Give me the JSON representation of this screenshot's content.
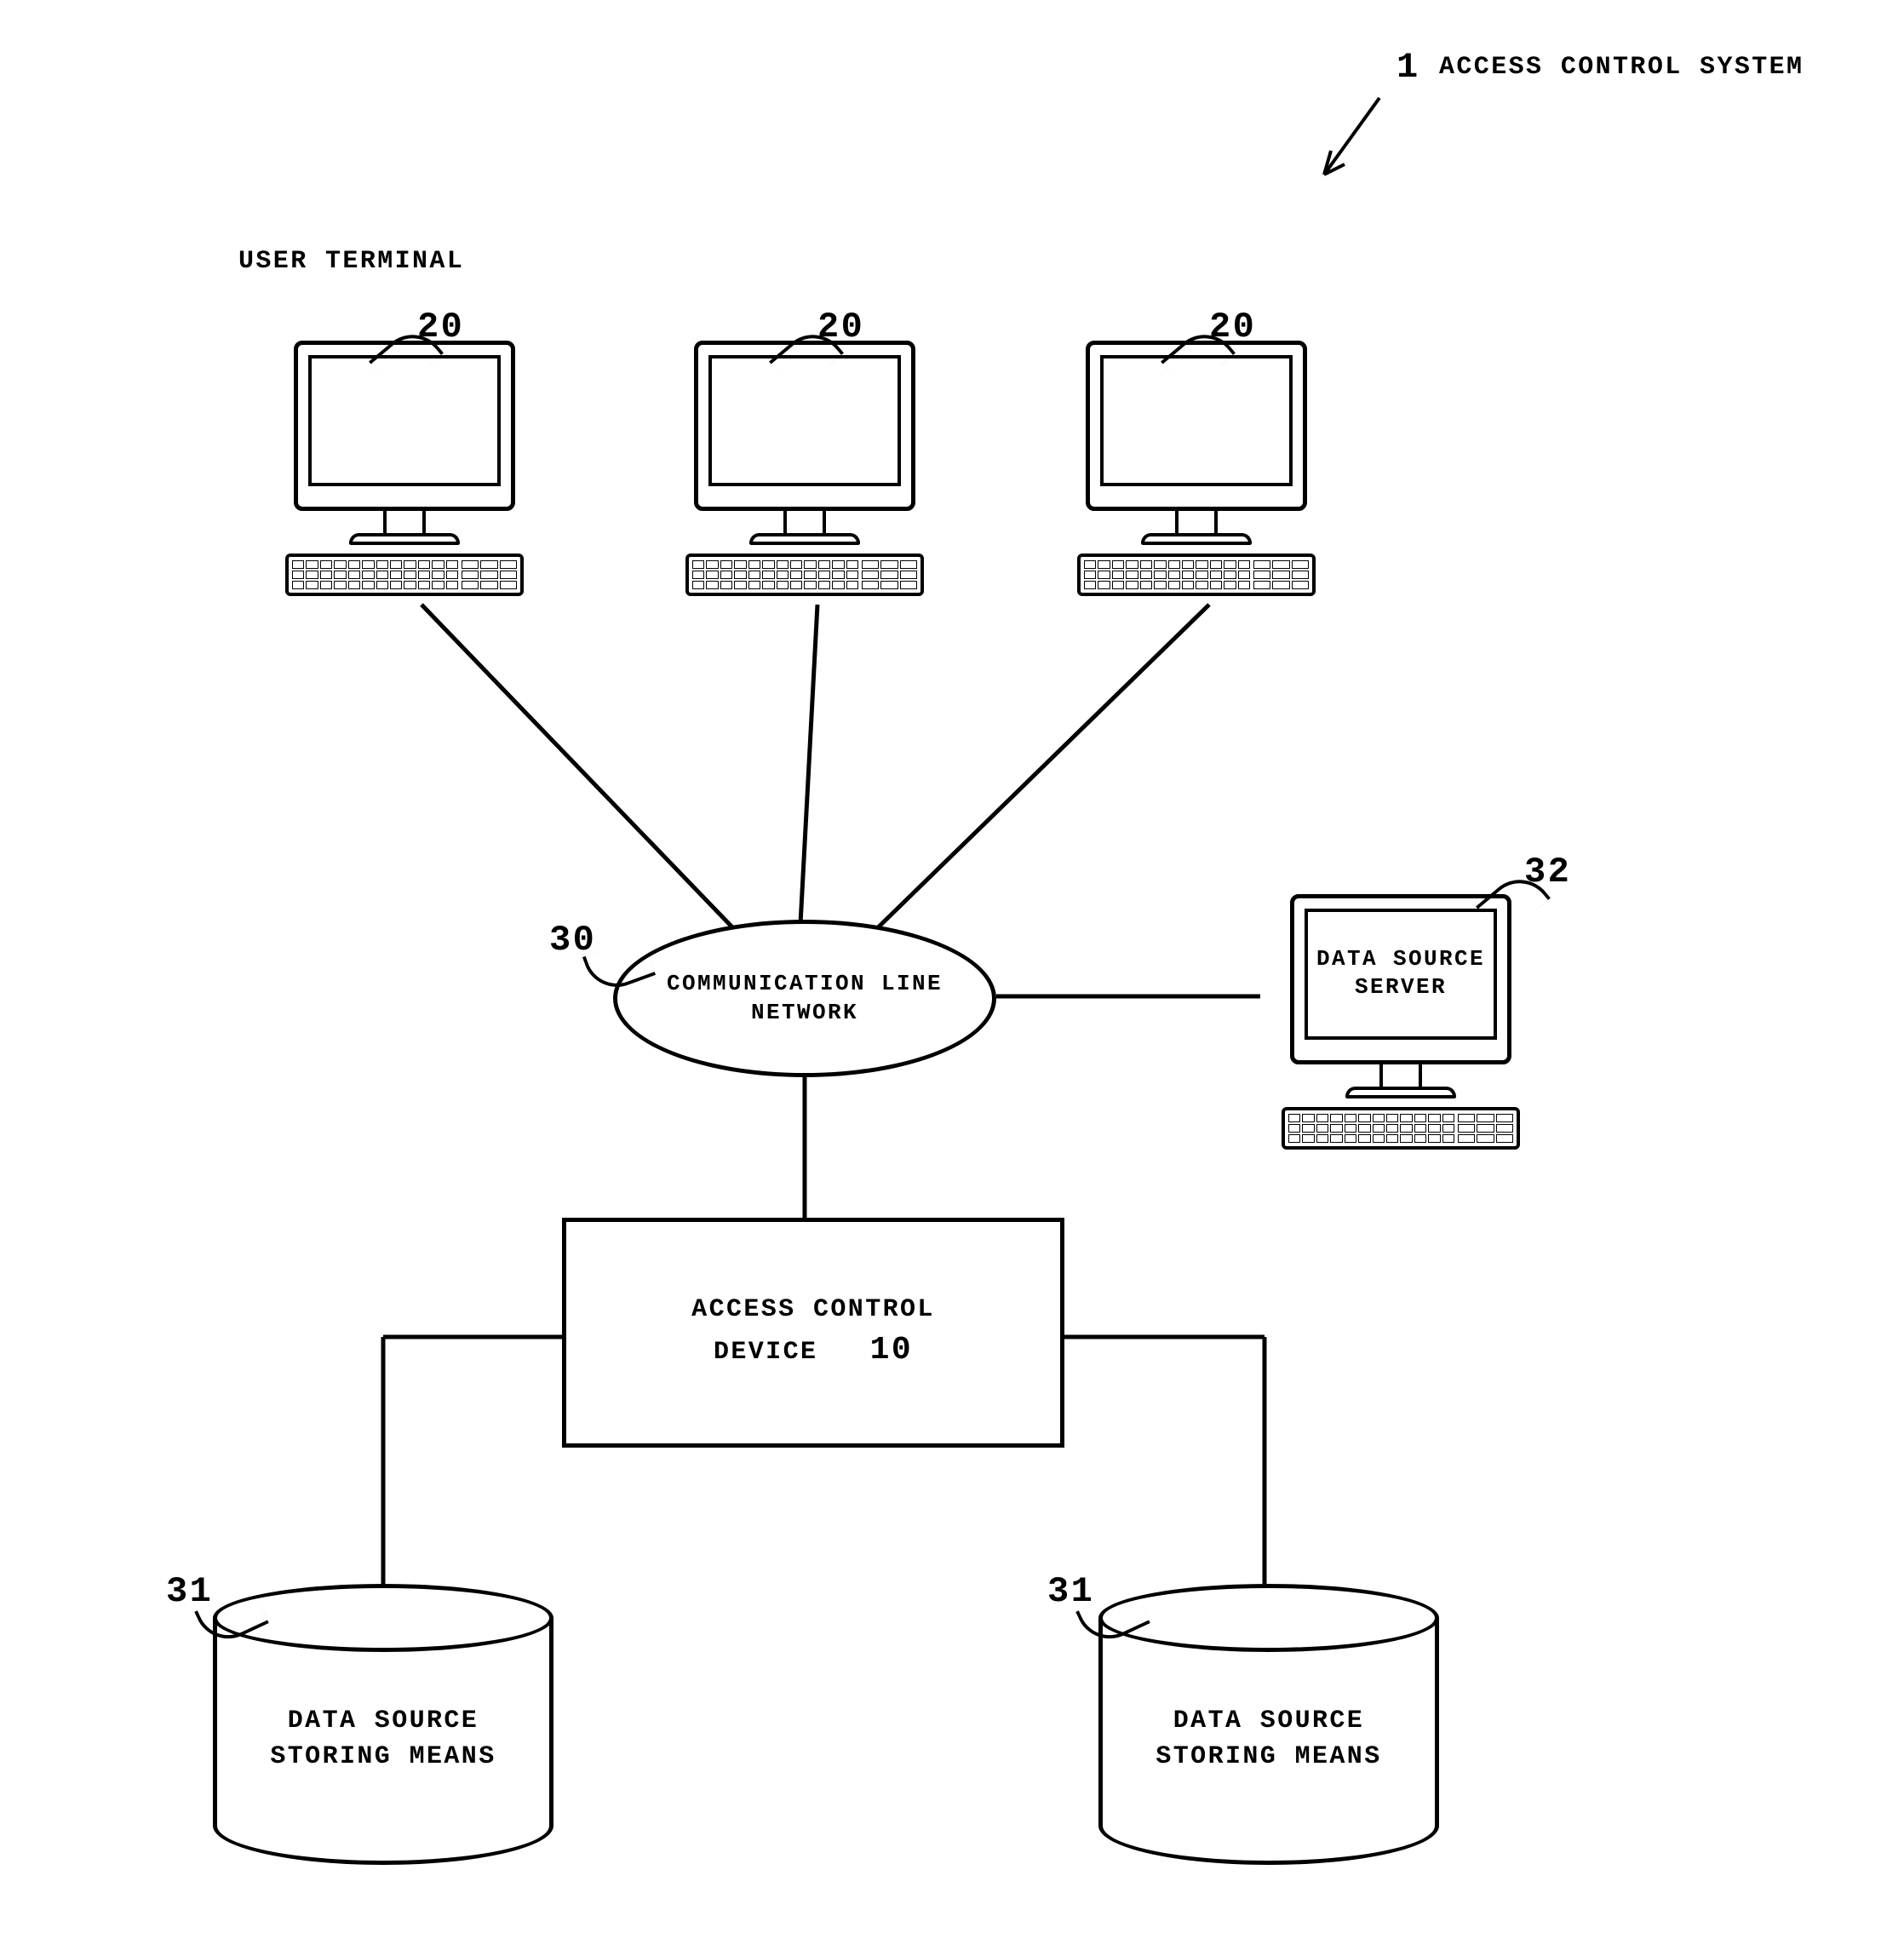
{
  "title_num": "1",
  "title_label": "ACCESS CONTROL SYSTEM",
  "user_terminal_label": "USER TERMINAL",
  "terminals": [
    {
      "num": "20"
    },
    {
      "num": "20"
    },
    {
      "num": "20"
    }
  ],
  "network": {
    "num": "30",
    "label_line1": "COMMUNICATION LINE",
    "label_line2": "NETWORK"
  },
  "data_source_server": {
    "num": "32",
    "label_line1": "DATA SOURCE",
    "label_line2": "SERVER"
  },
  "access_control": {
    "num": "10",
    "label_line1": "ACCESS CONTROL",
    "label_line2": "DEVICE"
  },
  "data_stores": [
    {
      "num": "31",
      "label_line1": "DATA SOURCE",
      "label_line2": "STORING MEANS"
    },
    {
      "num": "31",
      "label_line1": "DATA SOURCE",
      "label_line2": "STORING MEANS"
    }
  ]
}
